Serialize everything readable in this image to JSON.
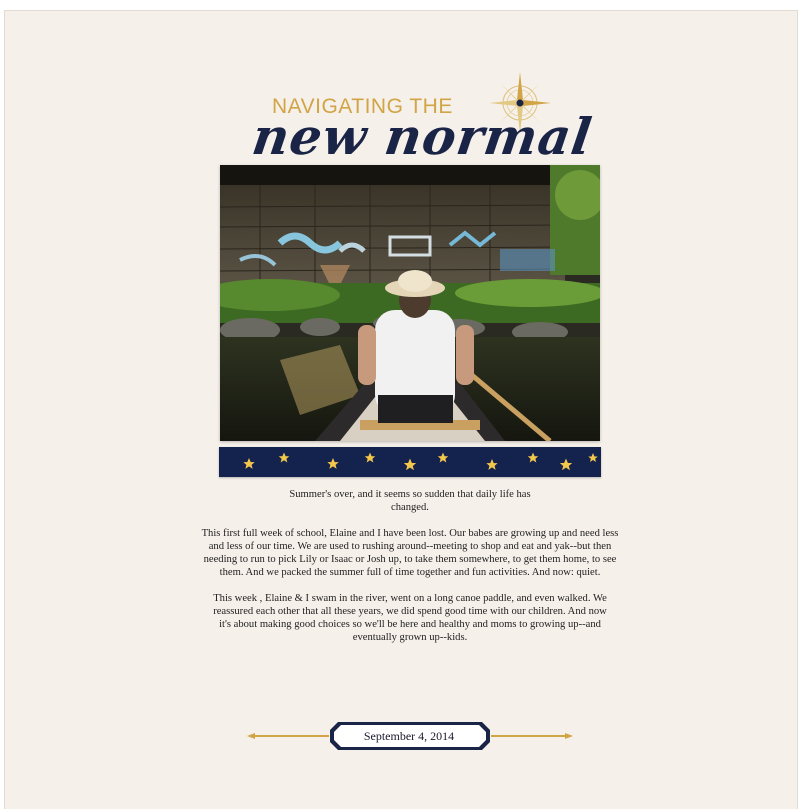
{
  "title": {
    "line1": "NAVIGATING THE",
    "line2": "new normal"
  },
  "photo": {
    "subject": "canoe-under-bridge-photo"
  },
  "journal": {
    "paragraph1": "Summer's over, and it seems so sudden that daily life has changed.",
    "paragraph2": "This first full week of school, Elaine and I have been lost. Our babes are growing up and need less and less of our time. We are used to rushing around--meeting to shop and eat and yak--but then needing to run to pick Lily or Isaac or Josh up, to take them somewhere, to get them home, to see them. And we packed the summer full of time together and fun activities. And now: quiet.",
    "paragraph3": "This week , Elaine & I swam in the river, went on a long canoe paddle, and even walked. We reassured each other that all these years, we did spend good time with our children. And now it's about making good choices so we'll be here and healthy and moms to growing up--and eventually grown up--kids."
  },
  "date": "September 4, 2014",
  "colors": {
    "background": "#f6f0ea",
    "navy": "#1a2447",
    "gold": "#d1a445"
  }
}
